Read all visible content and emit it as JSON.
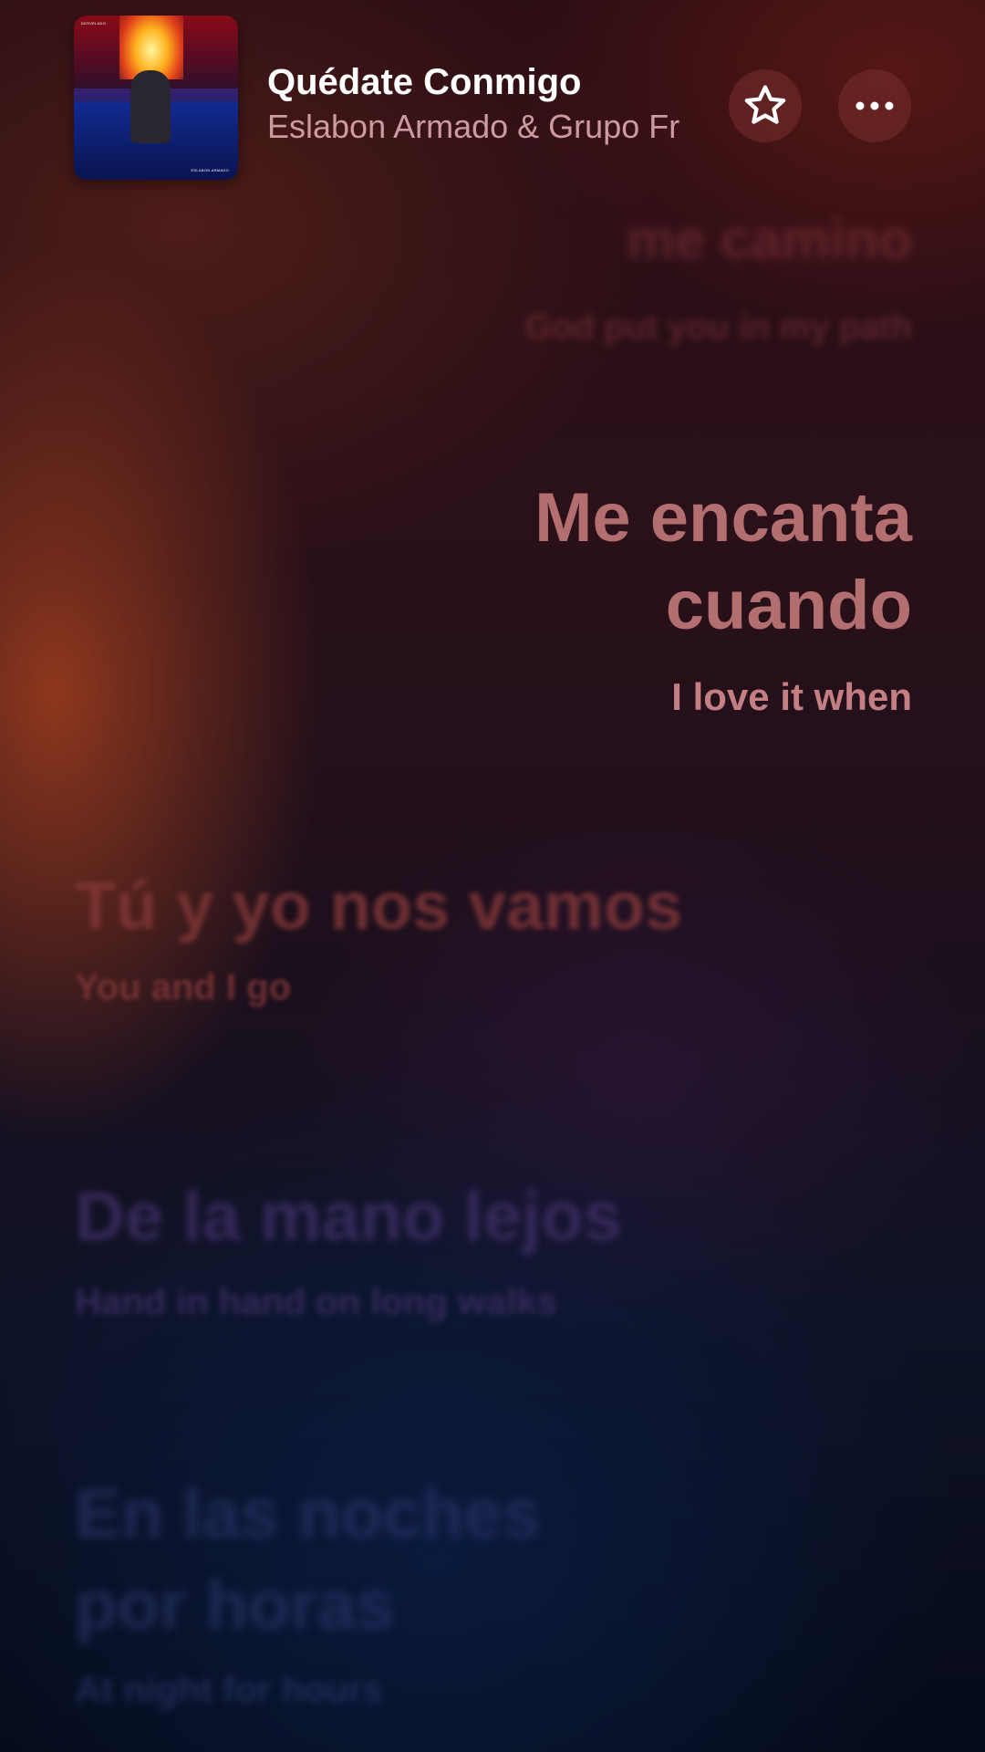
{
  "now_playing": {
    "title": "Quédate Conmigo",
    "artist": "Eslabon Armado & Grupo Fr",
    "artwork_text": [
      "DESVELADO",
      "ESLABON ARMADO"
    ]
  },
  "controls": {
    "favorite_icon": "star-icon",
    "more_icon": "ellipsis-icon"
  },
  "lyrics": [
    {
      "line": "me camino",
      "translation": "God put you in my path",
      "state": "past"
    },
    {
      "line": "Me encanta cuando",
      "line_parts": [
        "Me encanta",
        "cuando"
      ],
      "translation": "I love it when",
      "state": "current"
    },
    {
      "line": "Tú y yo nos vamos",
      "translation": "You and I go",
      "state": "upcoming"
    },
    {
      "line": "De la mano lejos",
      "translation": "Hand in hand on long walks",
      "state": "upcoming"
    },
    {
      "line": "En las noches por horas",
      "line_parts": [
        "En las noches",
        "por horas"
      ],
      "translation": "At night for hours",
      "state": "upcoming"
    }
  ],
  "colors": {
    "current_line": "#b36e70",
    "current_translation": "#c37f83",
    "artist_text": "#cc9aa0",
    "button_bg": "#6e2a2a"
  }
}
